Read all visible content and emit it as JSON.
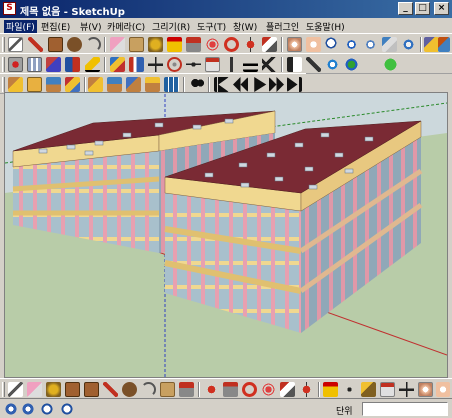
{
  "window": {
    "title": "제목 없음 - SketchUp",
    "controls": {
      "minimize": "_",
      "maximize": "□",
      "close": "×"
    }
  },
  "menu": [
    {
      "label": "파일(F)",
      "active": true
    },
    {
      "label": "편집(E)"
    },
    {
      "label": "뷰(V)"
    },
    {
      "label": "카메라(C)"
    },
    {
      "label": "그리기(R)"
    },
    {
      "label": "도구(T)"
    },
    {
      "label": "창(W)"
    },
    {
      "label": "플러그인"
    },
    {
      "label": "도움말(H)"
    }
  ],
  "toolbars": {
    "row1_icons": [
      "select-icon",
      "pencil-icon",
      "rectangle-icon",
      "circle-icon",
      "arc-icon",
      "eraser-icon",
      "shape-icon",
      "paint-bucket-icon",
      "tape-icon",
      "push-pull-icon",
      "follow-me-icon",
      "rotate-icon",
      "offset-icon",
      "move-icon",
      "orbit-icon",
      "pan-icon",
      "zoom-icon",
      "zoom-extents-icon",
      "walk-icon",
      "position-camera-icon",
      "look-around-icon",
      "section-icon",
      "paint-icon"
    ],
    "row2_icons": [
      "component-icon",
      "group-icon",
      "make-component-icon",
      "texture-icon",
      "warning-icon",
      "cube-icon",
      "plugin-icon",
      "axes-icon",
      "dimension-icon",
      "protractor-icon",
      "text-icon",
      "3d-text-icon",
      "axis-icon",
      "scissor-icon",
      "wand-icon",
      "ie-icon",
      "globe-icon",
      "help-icon"
    ],
    "row3_icons": [
      "iso-view-icon",
      "top-view-icon",
      "front-view-icon",
      "right-view-icon",
      "back-view-icon",
      "left-view-icon",
      "camera-icon",
      "first-frame-icon",
      "previous-frame-icon",
      "play-icon",
      "next-frame-icon",
      "last-frame-icon"
    ],
    "bottom_icons": [
      "select-icon",
      "eraser-icon",
      "paint-icon",
      "rectangle-icon",
      "pencil-icon",
      "circle-icon",
      "arc-icon",
      "shape-icon",
      "push-pull-icon",
      "follow-me-icon",
      "move-icon",
      "rotate-icon",
      "scale-icon",
      "offset-icon",
      "tape-icon",
      "dimension-icon",
      "protractor-icon",
      "text-icon",
      "axis-icon",
      "3d-text-icon",
      "orbit-icon",
      "pan-icon",
      "zoom-icon",
      "walk-icon"
    ]
  },
  "colors": {
    "roof": "#7a2a34",
    "slab": "#f0d890",
    "column": "#e8a0b0",
    "glass": "#a8c0cc",
    "ground": "#b8cca8",
    "sky": "#ccd8dc"
  },
  "status": {
    "unit_label": "단위",
    "unit_value": ""
  }
}
